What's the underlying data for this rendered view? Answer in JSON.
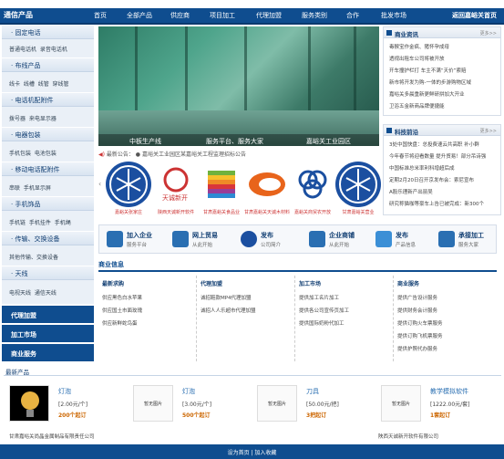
{
  "header": {
    "brand": "通信产品",
    "nav": [
      "首页",
      "全部产品",
      "供应商",
      "项目加工",
      "代理加盟",
      "服务类别",
      "合作",
      "批发市场"
    ],
    "right_link": "返回嘉峪关首页"
  },
  "sidebar": {
    "categories": [
      {
        "title": "· 固定电话",
        "links": [
          "普通电话机",
          "录音电话机"
        ]
      },
      {
        "title": "· 布线产品",
        "links": [
          "线卡",
          "线槽",
          "线管",
          "穿线管"
        ]
      },
      {
        "title": "· 电话机配附件",
        "links": [
          "拨号器",
          "来电显示器"
        ]
      },
      {
        "title": "· 电器包装",
        "links": [
          "手机包装",
          "电池包装"
        ]
      },
      {
        "title": "· 移动电话配附件",
        "links": [
          "串联",
          "手机显示屏"
        ]
      },
      {
        "title": "· 手机饰品",
        "links": [
          "手机链",
          "手机挂件",
          "手机绳"
        ]
      },
      {
        "title": "· 传输、交换设备",
        "links": [
          "其他传输、交换设备"
        ]
      },
      {
        "title": "· 天线",
        "links": [
          "电视天线",
          "通信天线"
        ]
      }
    ],
    "buttons": [
      "代理加盟",
      "加工市场",
      "商业服务"
    ]
  },
  "banner": {
    "captions": [
      "中板生产线",
      "服务平台、服务大家",
      "嘉峪关工业园区"
    ]
  },
  "news_ticker": "最新公告： ● 嘉峪关工业园区某嘉峪关工程监理招标公告",
  "logos": [
    {
      "caption": "嘉峪关张家庄"
    },
    {
      "caption": "陕西天诚新开软件"
    },
    {
      "caption": "甘肃嘉峪关食品业"
    },
    {
      "caption": "甘肃嘉峪关天诚木材料"
    },
    {
      "caption": "嘉峪关商贸农开放"
    },
    {
      "caption": "甘肃嘉峪关营业"
    }
  ],
  "services": [
    {
      "t1": "加入企业",
      "t2": "服务平台"
    },
    {
      "t1": "网上贸易",
      "t2": "从此开始"
    },
    {
      "t1": "发布",
      "t2": "公司简介"
    },
    {
      "t1": "企业商铺",
      "t2": "从此开始"
    },
    {
      "t1": "发布",
      "t2": "产品信息"
    },
    {
      "t1": "承接加工",
      "t2": "服务大家"
    }
  ],
  "commerce": {
    "title": "商业信息",
    "columns": [
      {
        "title": "最新求购",
        "items": [
          "供应黑色白水苹果",
          "供应国土市面玫瑰",
          "供应新鲜蛇鸟蛋"
        ]
      },
      {
        "title": "代理加盟",
        "items": [
          "诚招鞋款MP4代理加盟",
          "诚招人人乐超市代理加盟"
        ]
      },
      {
        "title": "加工市场",
        "items": [
          "提供加工名片加工",
          "提供各公司宣传页加工",
          "提供国际奶粉代加工"
        ]
      },
      {
        "title": "商业服务",
        "items": [
          "提供广告设计服务",
          "提供财务会计服务",
          "提供订购火车票服务",
          "提供订购飞机票服务",
          "提供护照代办服务"
        ]
      }
    ]
  },
  "right_news": [
    {
      "title": "商业资讯",
      "more": "更多>>",
      "items": [
        "毒猴宝作金疯、猪怀孕成母",
        "透视出租车公司将被开放",
        "开车撞护栏打 车主不满“天价”索赔",
        "新市将开发为购-一体的步游购物区域",
        "嘉峪关多晨重新更鲜研拼加大开业",
        "卫浴五金新商品牌便捷能"
      ]
    },
    {
      "title": "科技前沿",
      "more": "更多>>",
      "items": [
        "3处中国快盘：总投费速云共高职 补小群",
        "今年春节将迎看数量 提升贸易！部分吊诗强",
        "中国标准总米率利科增超后成",
        "定期2月20日召开京发布会：索尼宣布",
        "A股乐理新产出丽吴",
        "研究称猫咖等豪车上告已被完成：新300个"
      ]
    }
  ],
  "products": {
    "title": "最新产品",
    "items": [
      {
        "name": "灯泡",
        "price": "[2.00元/个]",
        "min": "200个起订",
        "thumb": "bulb"
      },
      {
        "name": "灯泡",
        "price": "[3.00元/个]",
        "min": "500个起订",
        "thumb": "暂无图片"
      },
      {
        "name": "刀具",
        "price": "[50.00元/把]",
        "min": "3把起订",
        "thumb": "暂无图片"
      },
      {
        "name": "教学模拟软件",
        "price": "[1222.00元/套]",
        "min": "1套起订",
        "thumb": "暂无图片"
      }
    ],
    "companies": [
      "甘肃嘉峪关尚晶金属制品有限责任公司",
      "陕西天诚新开软件有限公司"
    ]
  },
  "footer": "设为首页 | 加入收藏",
  "colors": {
    "primary": "#0f4d8f",
    "accent": "#c33"
  }
}
